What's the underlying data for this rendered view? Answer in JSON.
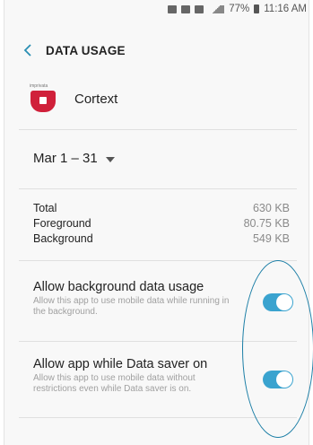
{
  "status_bar": {
    "battery": "77%",
    "time": "11:16 AM"
  },
  "app_bar": {
    "back_icon": "chevron-left-icon",
    "title": "DATA USAGE"
  },
  "app": {
    "brand_text": "imprivata",
    "name": "Cortext"
  },
  "date_range": {
    "label": "Mar 1 – 31"
  },
  "usage": [
    {
      "label": "Total",
      "value": "630 KB"
    },
    {
      "label": "Foreground",
      "value": "80.75 KB"
    },
    {
      "label": "Background",
      "value": "549 KB"
    }
  ],
  "settings": [
    {
      "title": "Allow background data usage",
      "description": "Allow this app to use mobile data while running in the background.",
      "enabled": true
    },
    {
      "title": "Allow app while Data saver on",
      "description": "Allow this app to use mobile data without restrictions even while Data saver is on.",
      "enabled": true
    }
  ],
  "colors": {
    "accent": "#3aa3cf",
    "annotation": "#1b7ea6",
    "app_icon": "#d0203a"
  }
}
